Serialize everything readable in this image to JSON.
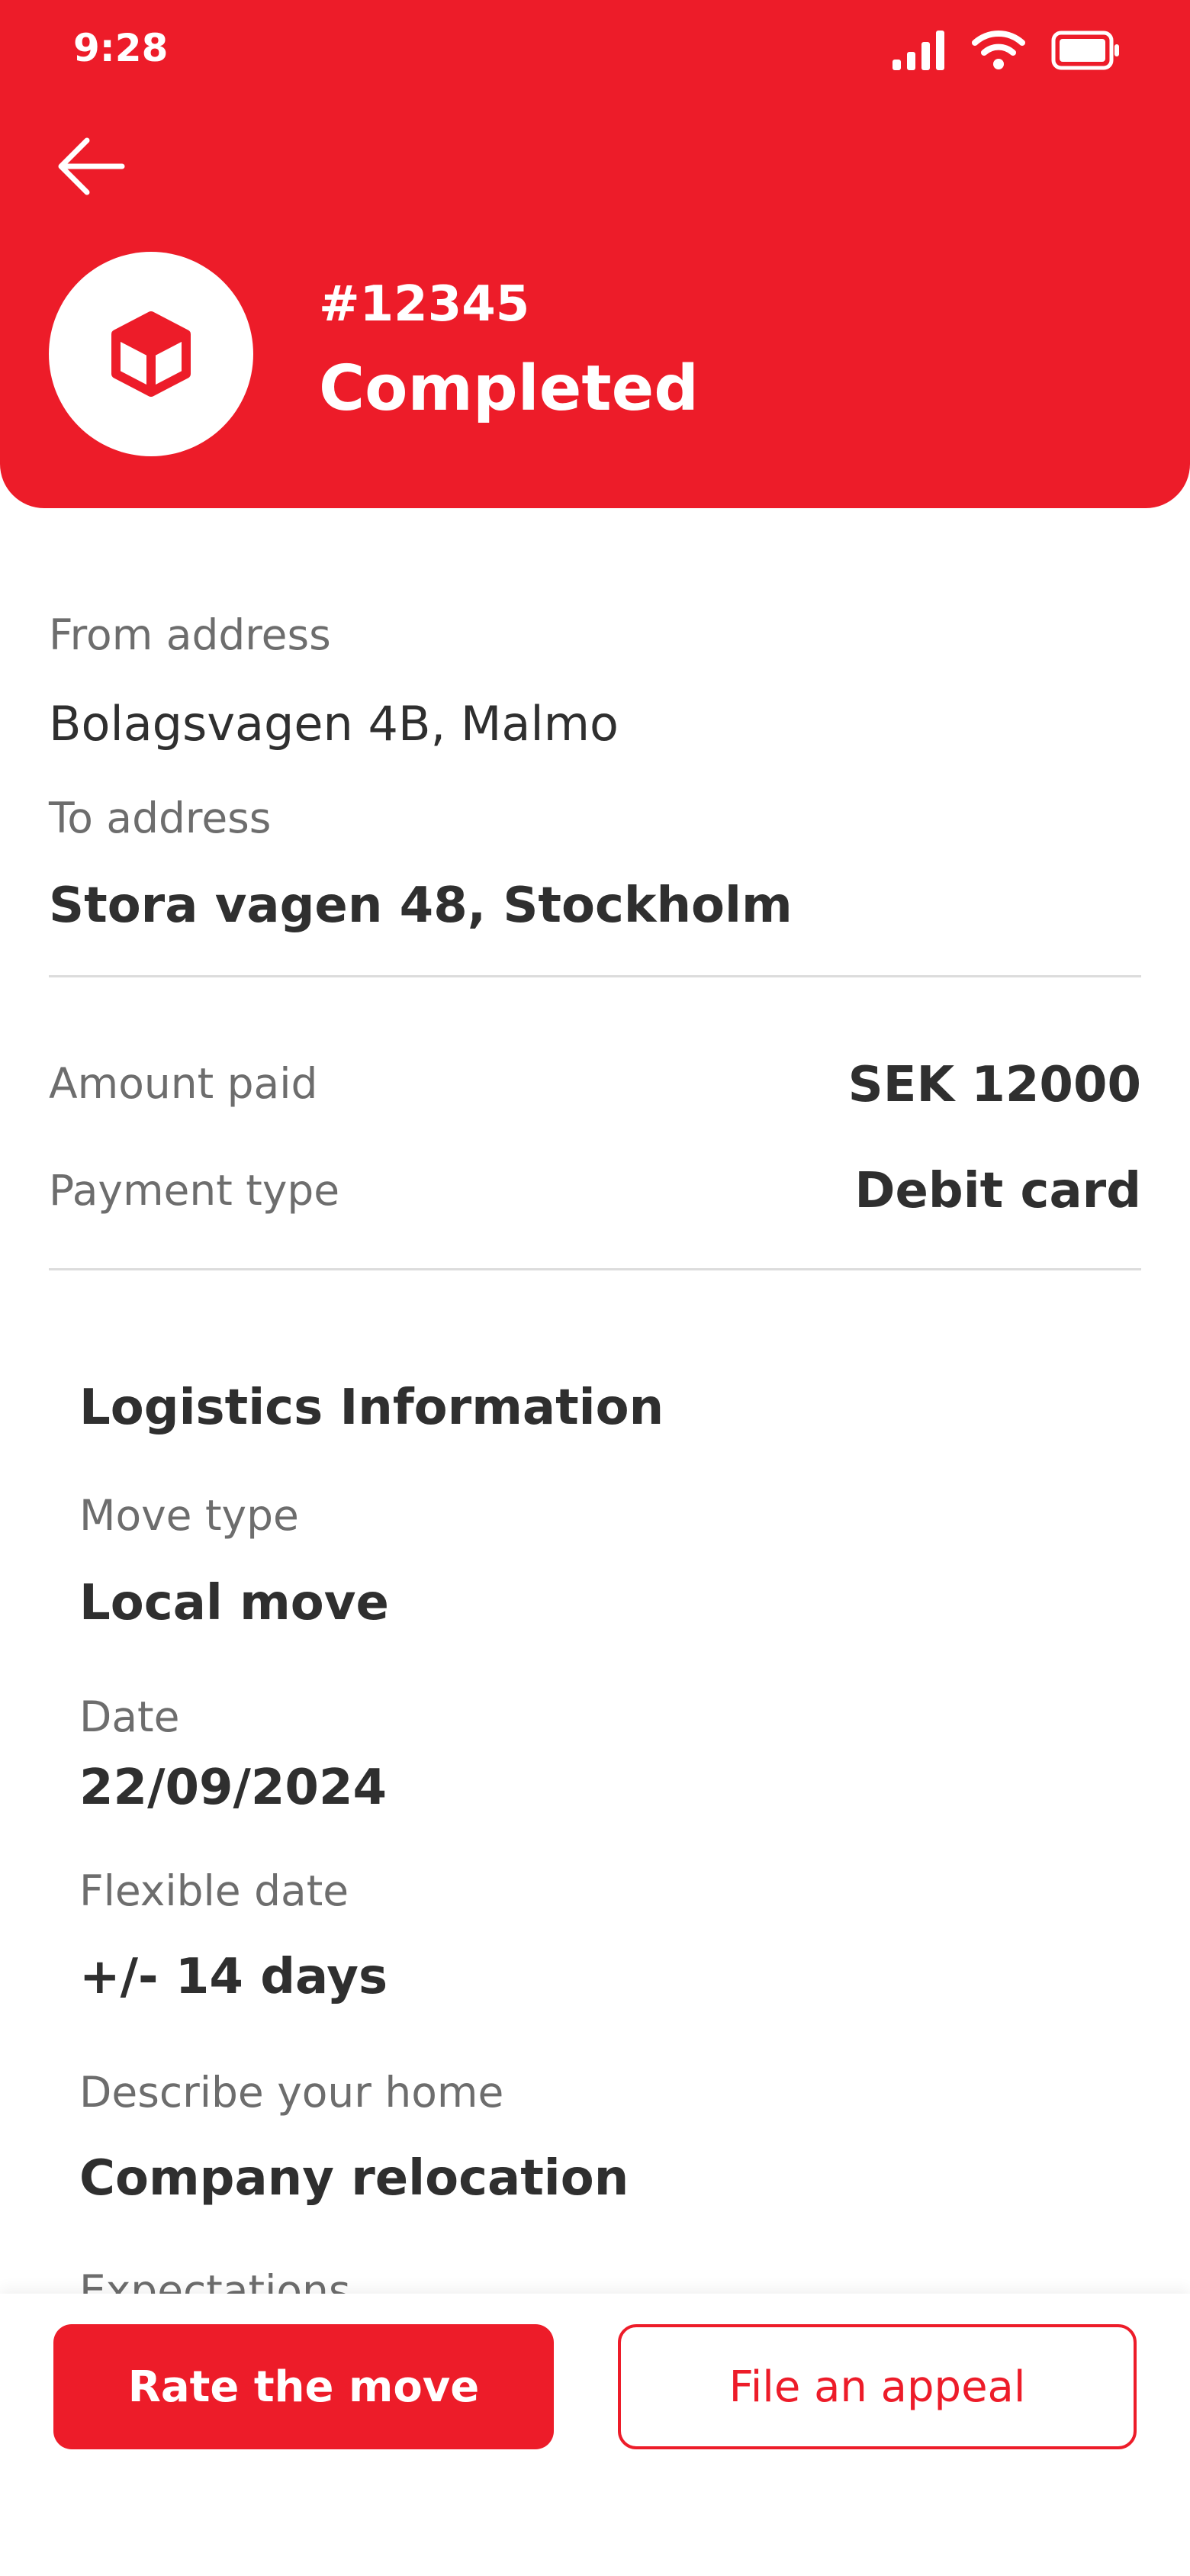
{
  "status_bar": {
    "time": "9:28"
  },
  "header": {
    "order_number": "#12345",
    "status": "Completed"
  },
  "addresses": {
    "from_label": "From address",
    "from_value": "Bolagsvagen 4B, Malmo",
    "to_label": "To address",
    "to_value": "Stora vagen 48, Stockholm"
  },
  "payment": {
    "amount_label": "Amount paid",
    "amount_value": "SEK 12000",
    "type_label": "Payment type",
    "type_value": "Debit card"
  },
  "logistics": {
    "title": "Logistics Information",
    "move_type_label": "Move type",
    "move_type_value": "Local move",
    "date_label": "Date",
    "date_value": "22/09/2024",
    "flexible_label": "Flexible date",
    "flexible_value": "+/- 14 days",
    "home_label": "Describe your home",
    "home_value": "Company relocation",
    "expectations_label": "Expectations"
  },
  "actions": {
    "rate_label": "Rate the move",
    "appeal_label": "File an appeal"
  },
  "colors": {
    "brand": "#ed1c29"
  }
}
